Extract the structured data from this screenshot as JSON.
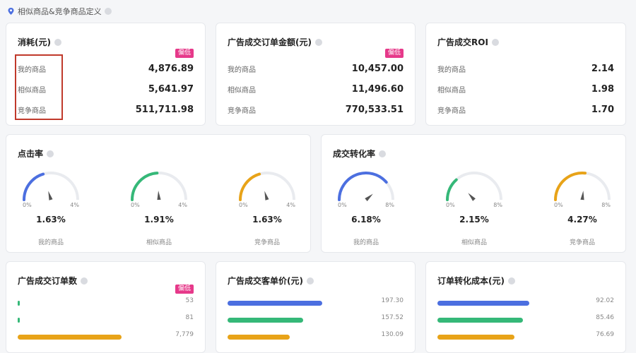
{
  "header": {
    "title": "相似商品&竞争商品定义"
  },
  "colors": {
    "blue": "#4c6fe0",
    "green": "#35b878",
    "orange": "#e8a318",
    "badge": "#e6398a"
  },
  "row_labels": [
    "我的商品",
    "相似商品",
    "竞争商品"
  ],
  "metric_cards": [
    {
      "title": "消耗(元)",
      "badge": "偏低",
      "values": [
        "4,876.89",
        "5,641.97",
        "511,711.98"
      ]
    },
    {
      "title": "广告成交订单金额(元)",
      "badge": "偏低",
      "values": [
        "10,457.00",
        "11,496.60",
        "770,533.51"
      ]
    },
    {
      "title": "广告成交ROI",
      "badge": "",
      "values": [
        "2.14",
        "1.98",
        "1.70"
      ]
    }
  ],
  "gauge_cards": [
    {
      "title": "点击率",
      "min": "0%",
      "max": "4%",
      "max_value": 4,
      "gauges": [
        {
          "value": 1.63,
          "label": "1.63%",
          "caption": "我的商品",
          "color": "#4c6fe0"
        },
        {
          "value": 1.91,
          "label": "1.91%",
          "caption": "相似商品",
          "color": "#35b878"
        },
        {
          "value": 1.63,
          "label": "1.63%",
          "caption": "竞争商品",
          "color": "#e8a318"
        }
      ]
    },
    {
      "title": "成交转化率",
      "min": "0%",
      "max": "8%",
      "max_value": 8,
      "gauges": [
        {
          "value": 6.18,
          "label": "6.18%",
          "caption": "我的商品",
          "color": "#4c6fe0"
        },
        {
          "value": 2.15,
          "label": "2.15%",
          "caption": "相似商品",
          "color": "#35b878"
        },
        {
          "value": 4.27,
          "label": "4.27%",
          "caption": "竞争商品",
          "color": "#e8a318"
        }
      ]
    }
  ],
  "bar_cards": [
    {
      "title": "广告成交订单数",
      "badge": "偏低",
      "max": 9000,
      "bars": [
        {
          "value": 53,
          "label": "53",
          "color": "#35b878"
        },
        {
          "value": 81,
          "label": "81",
          "color": "#35b878"
        },
        {
          "value": 7779,
          "label": "7,779",
          "color": "#e8a318"
        }
      ]
    },
    {
      "title": "广告成交客单价(元)",
      "badge": "",
      "max": 250,
      "bars": [
        {
          "value": 197.3,
          "label": "197.30",
          "color": "#4c6fe0"
        },
        {
          "value": 157.52,
          "label": "157.52",
          "color": "#35b878"
        },
        {
          "value": 130.09,
          "label": "130.09",
          "color": "#e8a318"
        }
      ]
    },
    {
      "title": "订单转化成本(元)",
      "badge": "",
      "max": 120,
      "bars": [
        {
          "value": 92.02,
          "label": "92.02",
          "color": "#4c6fe0"
        },
        {
          "value": 85.46,
          "label": "85.46",
          "color": "#35b878"
        },
        {
          "value": 76.69,
          "label": "76.69",
          "color": "#e8a318"
        }
      ]
    }
  ]
}
